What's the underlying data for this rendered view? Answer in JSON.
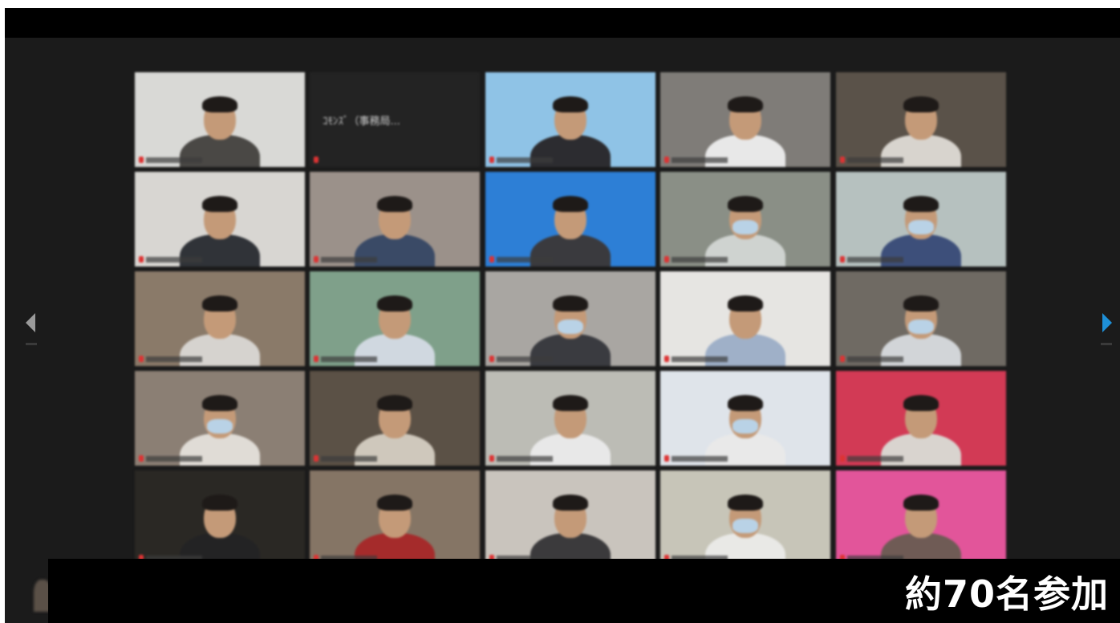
{
  "caption": {
    "text": "約70名参加"
  },
  "navigation": {
    "prev_icon": "chevron-left-icon",
    "next_icon": "chevron-right-icon",
    "next_color": "#1e90d8"
  },
  "highlight_color": "#c9e35a",
  "name_only_tile": {
    "text": "ｺﾓﾝｽﾞ（事務局..."
  },
  "tiles": [
    {
      "kind": "video",
      "bg": "#d9d9d6",
      "person": "#4a4845"
    },
    {
      "kind": "name"
    },
    {
      "kind": "video",
      "bg": "#8fc3e6",
      "person": "#2c2c30",
      "active": true
    },
    {
      "kind": "video",
      "bg": "#7f7c78",
      "person": "#e8e8e8"
    },
    {
      "kind": "video",
      "bg": "#5a5249",
      "person": "#d8d4ce"
    },
    {
      "kind": "video",
      "bg": "#d8d6d2",
      "person": "#303338"
    },
    {
      "kind": "video",
      "bg": "#9b918a",
      "person": "#3a4a66"
    },
    {
      "kind": "video",
      "bg": "#2d7fd6",
      "person": "#3a3a3e"
    },
    {
      "kind": "video",
      "bg": "#8a8f86",
      "person": "#cfd3d0",
      "mask": true
    },
    {
      "kind": "video",
      "bg": "#b6c1bf",
      "person": "#3d4f7a",
      "mask": true
    },
    {
      "kind": "video",
      "bg": "#8a7a69",
      "person": "#d6d3cf"
    },
    {
      "kind": "video",
      "bg": "#7fa08a",
      "person": "#d0d8e0"
    },
    {
      "kind": "video",
      "bg": "#a9a6a2",
      "person": "#3a3b40",
      "mask": true
    },
    {
      "kind": "video",
      "bg": "#e6e5e2",
      "person": "#9fb0c8"
    },
    {
      "kind": "video",
      "bg": "#6f6a63",
      "person": "#d2d5d8",
      "mask": true
    },
    {
      "kind": "video",
      "bg": "#8b7f74",
      "person": "#e0dcd6",
      "mask": true
    },
    {
      "kind": "video",
      "bg": "#5b5146",
      "person": "#cfc8bc"
    },
    {
      "kind": "video",
      "bg": "#bcbcb5",
      "person": "#e8e8e8"
    },
    {
      "kind": "video",
      "bg": "#dfe4ea",
      "person": "#e9e9e9",
      "mask": true
    },
    {
      "kind": "video",
      "bg": "#d23a55",
      "person": "#d9d4cf"
    },
    {
      "kind": "video",
      "bg": "#2a2824",
      "person": "#232324"
    },
    {
      "kind": "video",
      "bg": "#857565",
      "person": "#a52b2b"
    },
    {
      "kind": "video",
      "bg": "#c9c4bd",
      "person": "#3b3a3c"
    },
    {
      "kind": "video",
      "bg": "#c7c5b8",
      "person": "#e9e9e6",
      "mask": true
    },
    {
      "kind": "video",
      "bg": "#e2559a",
      "person": "#6f5b55"
    }
  ]
}
